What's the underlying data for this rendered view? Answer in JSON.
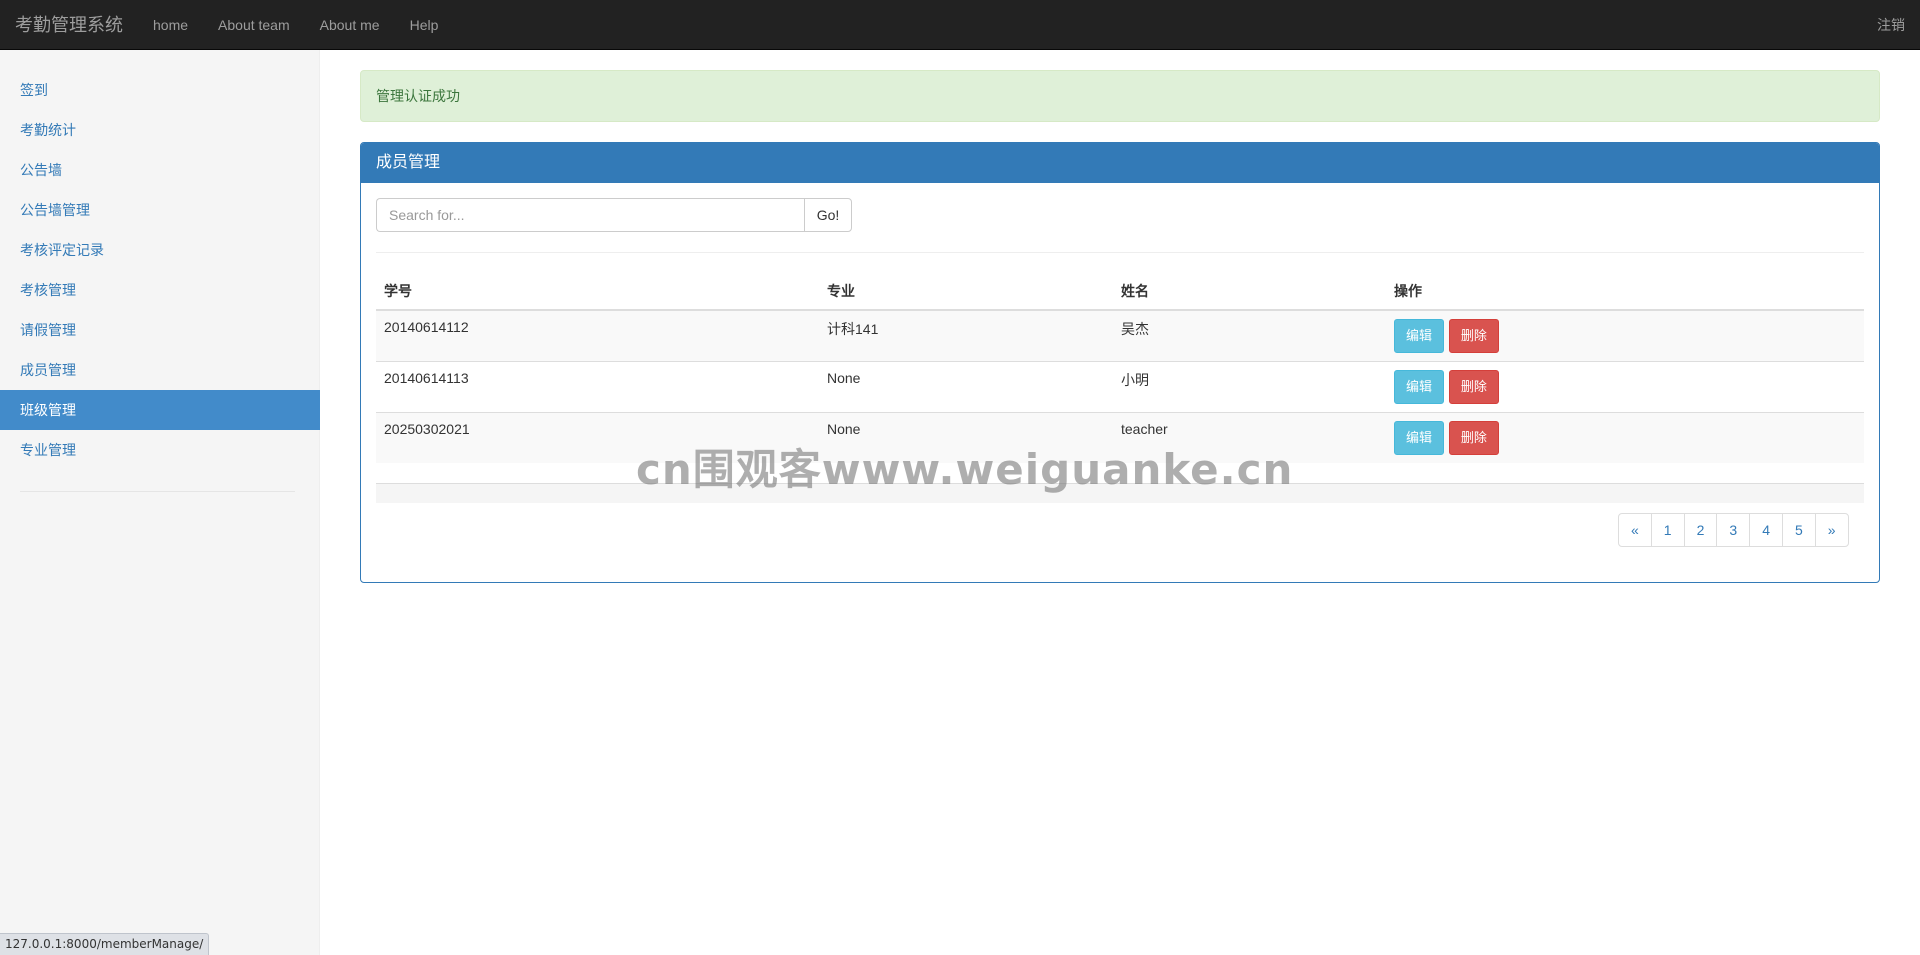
{
  "navbar": {
    "brand": "考勤管理系统",
    "links": [
      "home",
      "About team",
      "About me",
      "Help"
    ],
    "logout": "注销"
  },
  "sidebar": {
    "items": [
      {
        "label": "签到",
        "active": false
      },
      {
        "label": "考勤统计",
        "active": false
      },
      {
        "label": "公告墙",
        "active": false
      },
      {
        "label": "公告墙管理",
        "active": false
      },
      {
        "label": "考核评定记录",
        "active": false
      },
      {
        "label": "考核管理",
        "active": false
      },
      {
        "label": "请假管理",
        "active": false
      },
      {
        "label": "成员管理",
        "active": false
      },
      {
        "label": "班级管理",
        "active": true
      },
      {
        "label": "专业管理",
        "active": false
      }
    ]
  },
  "alert": {
    "text": "管理认证成功",
    "color": "#dff0d8"
  },
  "panel": {
    "title": "成员管理",
    "header_color": "#337ab7",
    "search": {
      "placeholder": "Search for...",
      "value": "",
      "button_label": "Go!"
    },
    "table": {
      "columns": [
        "学号",
        "专业",
        "姓名",
        "操作"
      ],
      "rows": [
        {
          "id": "20140614112",
          "major": "计科141",
          "name": "吴杰"
        },
        {
          "id": "20140614113",
          "major": "None",
          "name": "小明"
        },
        {
          "id": "20250302021",
          "major": "None",
          "name": "teacher"
        }
      ],
      "edit_label": "编辑",
      "delete_label": "删除"
    },
    "pagination": [
      "«",
      "1",
      "2",
      "3",
      "4",
      "5",
      "»"
    ]
  },
  "watermark": "cn围观客www.weiguanke.cn",
  "statusbar": "127.0.0.1:8000/memberManage/"
}
